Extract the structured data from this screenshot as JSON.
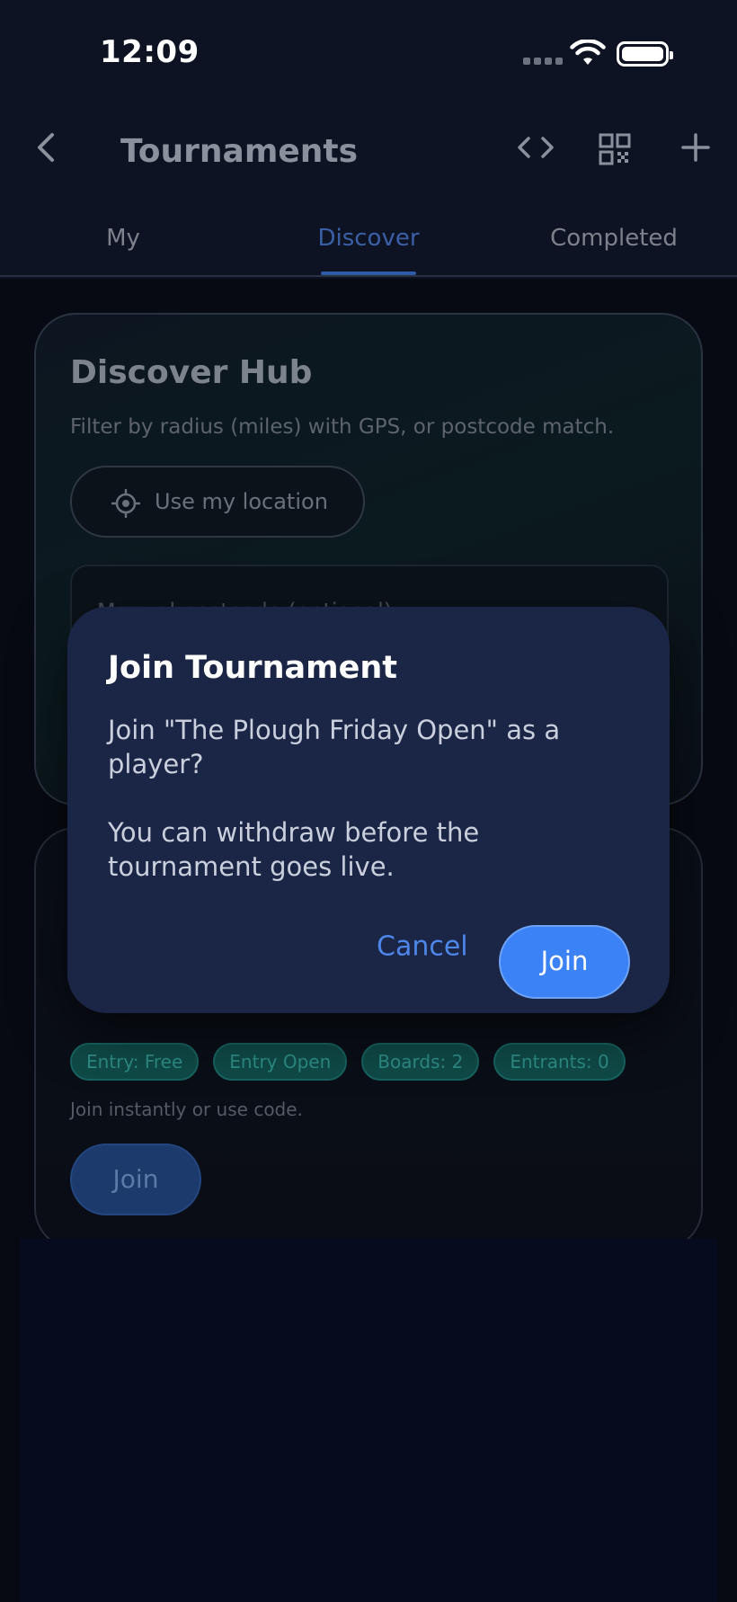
{
  "status_bar": {
    "time": "12:09"
  },
  "header": {
    "title": "Tournaments",
    "icons": {
      "back": "chevron-left-icon",
      "code": "code-icon",
      "qr": "qr-code-icon",
      "add": "plus-icon"
    }
  },
  "tabs": [
    {
      "label": "My",
      "active": false
    },
    {
      "label": "Discover",
      "active": true
    },
    {
      "label": "Completed",
      "active": false
    }
  ],
  "discover_hub": {
    "title": "Discover Hub",
    "subtitle": "Filter by radius (miles) with GPS, or postcode match.",
    "location_button": "Use my location",
    "postcode_placeholder": "Manual postcode (optional)"
  },
  "tournament_card": {
    "chips": [
      "Entry: Free",
      "Entry Open",
      "Boards: 2",
      "Entrants: 0"
    ],
    "note": "Join instantly or use code.",
    "join_label": "Join"
  },
  "dialog": {
    "title": "Join Tournament",
    "message_line1": "Join \"The Plough Friday Open\" as a player?",
    "message_line2": "You can withdraw before the tournament goes live.",
    "cancel_label": "Cancel",
    "confirm_label": "Join"
  },
  "colors": {
    "accent": "#3b82f6",
    "dialog_bg": "#1b2545",
    "chip_bg": "#0f4a47"
  }
}
